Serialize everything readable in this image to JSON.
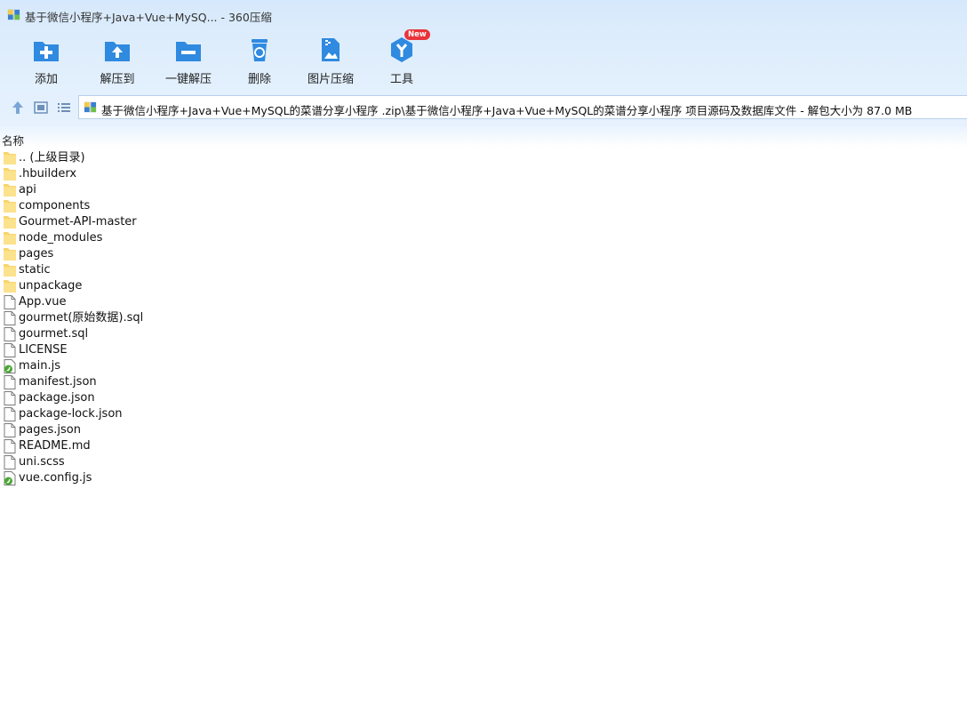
{
  "window": {
    "title": "基于微信小程序+Java+Vue+MySQ... - 360压缩"
  },
  "toolbar": {
    "buttons": [
      {
        "label": "添加",
        "icon": "add-icon"
      },
      {
        "label": "解压到",
        "icon": "extract-to-icon"
      },
      {
        "label": "一键解压",
        "icon": "one-click-extract-icon"
      },
      {
        "label": "删除",
        "icon": "delete-icon"
      },
      {
        "label": "图片压缩",
        "icon": "image-compress-icon"
      },
      {
        "label": "工具",
        "icon": "tools-icon",
        "badge": "New"
      }
    ]
  },
  "address": {
    "path": "基于微信小程序+Java+Vue+MySQL的菜谱分享小程序 .zip\\基于微信小程序+Java+Vue+MySQL的菜谱分享小程序 项目源码及数据库文件 - 解包大小为 87.0 MB"
  },
  "list": {
    "column_name": "名称",
    "items": [
      {
        "name": ".. (上级目录)",
        "type": "folder"
      },
      {
        "name": ".hbuilderx",
        "type": "folder"
      },
      {
        "name": "api",
        "type": "folder"
      },
      {
        "name": "components",
        "type": "folder"
      },
      {
        "name": "Gourmet-API-master",
        "type": "folder"
      },
      {
        "name": "node_modules",
        "type": "folder"
      },
      {
        "name": "pages",
        "type": "folder"
      },
      {
        "name": "static",
        "type": "folder"
      },
      {
        "name": "unpackage",
        "type": "folder"
      },
      {
        "name": "App.vue",
        "type": "file"
      },
      {
        "name": "gourmet(原始数据).sql",
        "type": "file"
      },
      {
        "name": "gourmet.sql",
        "type": "file"
      },
      {
        "name": "LICENSE",
        "type": "file"
      },
      {
        "name": "main.js",
        "type": "js"
      },
      {
        "name": "manifest.json",
        "type": "file"
      },
      {
        "name": "package.json",
        "type": "file"
      },
      {
        "name": "package-lock.json",
        "type": "file"
      },
      {
        "name": "pages.json",
        "type": "file"
      },
      {
        "name": "README.md",
        "type": "file"
      },
      {
        "name": "uni.scss",
        "type": "file"
      },
      {
        "name": "vue.config.js",
        "type": "js"
      }
    ]
  },
  "colors": {
    "accent": "#2f8ae0",
    "folder": "#f7d66a",
    "badge": "#e8343a"
  }
}
